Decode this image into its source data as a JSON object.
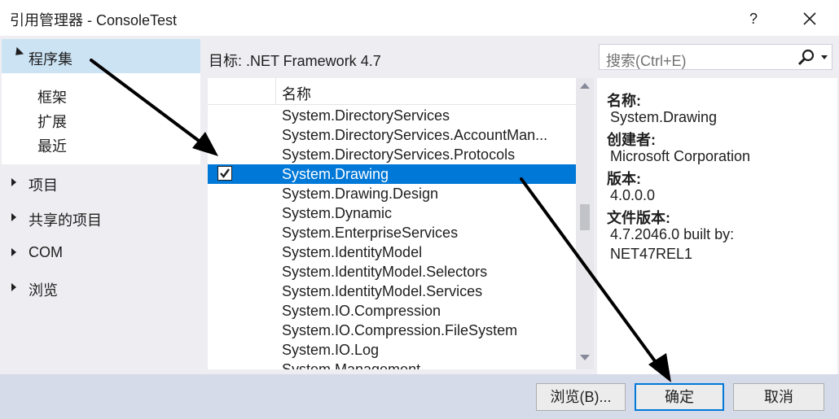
{
  "window": {
    "title": "引用管理器 - ConsoleTest",
    "help_label": "?"
  },
  "nav": {
    "assemblies": "程序集",
    "sub_items": [
      "框架",
      "扩展",
      "最近"
    ],
    "groups": [
      "项目",
      "共享的项目",
      "COM",
      "浏览"
    ]
  },
  "target": "目标: .NET Framework 4.7",
  "search": {
    "placeholder": "搜索(Ctrl+E)"
  },
  "list": {
    "header_name": "名称",
    "rows": [
      {
        "name": "System.DirectoryServices",
        "checked": false,
        "selected": false
      },
      {
        "name": "System.DirectoryServices.AccountMan...",
        "checked": false,
        "selected": false
      },
      {
        "name": "System.DirectoryServices.Protocols",
        "checked": false,
        "selected": false
      },
      {
        "name": "System.Drawing",
        "checked": true,
        "selected": true
      },
      {
        "name": "System.Drawing.Design",
        "checked": false,
        "selected": false
      },
      {
        "name": "System.Dynamic",
        "checked": false,
        "selected": false
      },
      {
        "name": "System.EnterpriseServices",
        "checked": false,
        "selected": false
      },
      {
        "name": "System.IdentityModel",
        "checked": false,
        "selected": false
      },
      {
        "name": "System.IdentityModel.Selectors",
        "checked": false,
        "selected": false
      },
      {
        "name": "System.IdentityModel.Services",
        "checked": false,
        "selected": false
      },
      {
        "name": "System.IO.Compression",
        "checked": false,
        "selected": false
      },
      {
        "name": "System.IO.Compression.FileSystem",
        "checked": false,
        "selected": false
      },
      {
        "name": "System.IO.Log",
        "checked": false,
        "selected": false
      },
      {
        "name": "System.Management",
        "checked": false,
        "selected": false
      }
    ]
  },
  "details": {
    "name_label": "名称:",
    "name_value": "System.Drawing",
    "creator_label": "创建者:",
    "creator_value": "Microsoft Corporation",
    "version_label": "版本:",
    "version_value": "4.0.0.0",
    "file_version_label": "文件版本:",
    "file_version_line1": "4.7.2046.0 built by:",
    "file_version_line2": "NET47REL1"
  },
  "buttons": {
    "browse": "浏览(B)...",
    "ok": "确定",
    "cancel": "取消"
  },
  "colors": {
    "selection": "#0078d7",
    "nav_selected": "#cce3f4",
    "footer": "#d6dbe9",
    "annotation_arrow": "#000000"
  }
}
